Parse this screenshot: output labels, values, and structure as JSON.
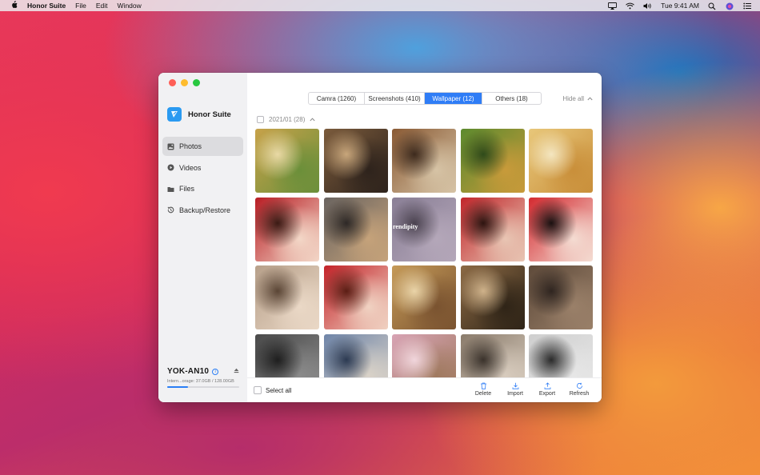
{
  "menubar": {
    "apple_icon": "apple-icon",
    "app_name": "Honor Suite",
    "menus": [
      "File",
      "Edit",
      "Window"
    ],
    "clock": "Tue 9:41 AM"
  },
  "app": {
    "brand_name": "Honor Suite",
    "nav": [
      {
        "label": "Photos",
        "icon": "photos-icon",
        "active": true
      },
      {
        "label": "Videos",
        "icon": "videos-icon",
        "active": false
      },
      {
        "label": "Files",
        "icon": "folder-icon",
        "active": false
      },
      {
        "label": "Backup/Restore",
        "icon": "backup-icon",
        "active": false
      }
    ],
    "device": {
      "name": "YOK-AN10",
      "storage_text": "Intern...orage: 37.0GB / 128.00GB",
      "used_gb": 37.0,
      "total_gb": 128.0
    }
  },
  "tabs": [
    {
      "label": "Camra (1260)",
      "active": false
    },
    {
      "label": "Screenshots (410)",
      "active": false
    },
    {
      "label": "Wallpaper (12)",
      "active": true
    },
    {
      "label": "Others (18)",
      "active": false
    }
  ],
  "hide_all_label": "Hide all",
  "group": {
    "label": "2021/01 (28)"
  },
  "photos": [
    {
      "subject": "jar with pine cone decor",
      "colors": [
        "#c7a24a",
        "#6b8f3a",
        "#e9d9a5"
      ]
    },
    {
      "subject": "tabby cat on rug",
      "colors": [
        "#7b5b3c",
        "#2e231c",
        "#c8a67b"
      ]
    },
    {
      "subject": "driftwood sculpture",
      "colors": [
        "#8a5a34",
        "#d6c3a5",
        "#3d2a1d"
      ]
    },
    {
      "subject": "potted succulents",
      "colors": [
        "#5c8a2e",
        "#c89a3a",
        "#2f4a1a"
      ]
    },
    {
      "subject": "glass cake dome",
      "colors": [
        "#e8c77a",
        "#c98f3a",
        "#f4e6c0"
      ]
    },
    {
      "subject": "woman in red with flowers",
      "colors": [
        "#b81d24",
        "#f3d7c7",
        "#3a1a14"
      ]
    },
    {
      "subject": "cat lying on back",
      "colors": [
        "#6a6460",
        "#c5a27a",
        "#2d2826"
      ]
    },
    {
      "subject": "cat with serendipity text",
      "text": "rendipity",
      "colors": [
        "#8a7f96",
        "#b4a7b9",
        "#4b4350"
      ]
    },
    {
      "subject": "woman with hair ornaments",
      "colors": [
        "#c1262b",
        "#e8c5b3",
        "#2d1410"
      ]
    },
    {
      "subject": "woman in red sweater",
      "colors": [
        "#d42a30",
        "#f4dcd2",
        "#1a1010"
      ]
    },
    {
      "subject": "cat paws up",
      "colors": [
        "#b7a08a",
        "#ead8c6",
        "#5a4535"
      ]
    },
    {
      "subject": "woman with red floral headpiece",
      "colors": [
        "#c32228",
        "#f0d2c2",
        "#5b1d14"
      ]
    },
    {
      "subject": "cat face tilted",
      "colors": [
        "#c59a58",
        "#7a5330",
        "#ead4a8"
      ]
    },
    {
      "subject": "tabby cat sleeping",
      "colors": [
        "#8c6a45",
        "#2f2417",
        "#cfb28a"
      ]
    },
    {
      "subject": "dry grass field",
      "colors": [
        "#5e4a3a",
        "#9a8069",
        "#2f2520"
      ]
    },
    {
      "subject": "black and white tower",
      "colors": [
        "#4a4a4a",
        "#8a8a8a",
        "#1e1e1e"
      ]
    },
    {
      "subject": "harbor with boat",
      "colors": [
        "#6f85a8",
        "#d9d2c8",
        "#2c3a52"
      ]
    },
    {
      "subject": "cat with flowers",
      "colors": [
        "#d8a3b4",
        "#a07a60",
        "#f1d6dc"
      ]
    },
    {
      "subject": "owl figurine and cat",
      "colors": [
        "#8a7b6b",
        "#d7cbbd",
        "#3a322b"
      ]
    },
    {
      "subject": "foggy sky silhouette",
      "colors": [
        "#cfcfcf",
        "#e6e6e6",
        "#2a2a2a"
      ]
    }
  ],
  "footer": {
    "select_all": "Select all",
    "actions": [
      {
        "label": "Delete",
        "icon": "trash-icon"
      },
      {
        "label": "Import",
        "icon": "import-icon"
      },
      {
        "label": "Export",
        "icon": "export-icon"
      },
      {
        "label": "Refresh",
        "icon": "refresh-icon"
      }
    ]
  },
  "colors": {
    "accent": "#2f7df6",
    "sidebar_bg": "#f1f1f3",
    "active_nav_bg": "#dcdcdf"
  }
}
